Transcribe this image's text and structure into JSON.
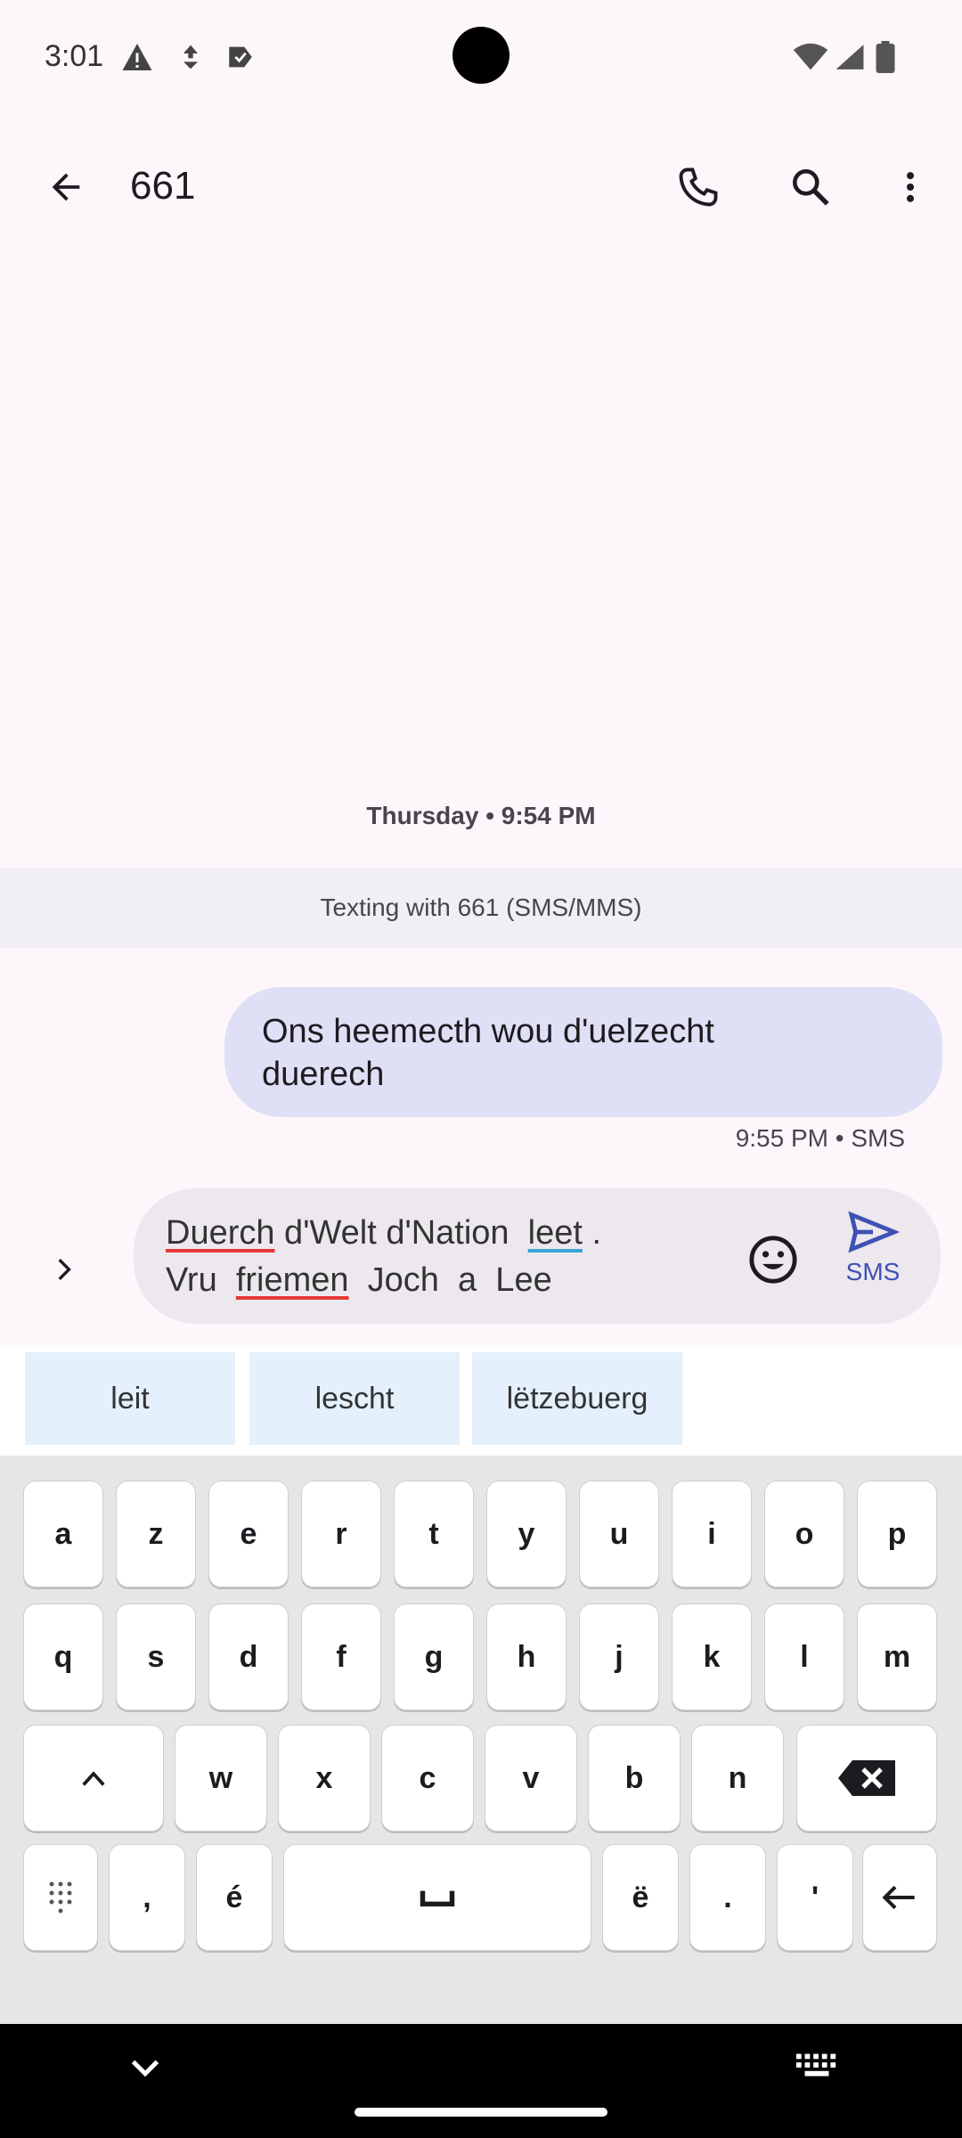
{
  "status_bar": {
    "time": "3:01"
  },
  "header": {
    "title": "661"
  },
  "conversation": {
    "date_divider": "Thursday • 9:54 PM",
    "texting_banner": "Texting with 661 (SMS/MMS)",
    "messages": [
      {
        "text_line1": "Ons heemecth  wou d'uelzecht",
        "text_line2": "duerech",
        "meta": "9:55 PM • SMS"
      }
    ]
  },
  "compose": {
    "words": [
      "Duerch",
      " d'Welt d'Nation  ",
      "leet",
      " .",
      "Vru  ",
      "friemen",
      "  Joch  a  Lee"
    ],
    "send_label": "SMS"
  },
  "keyboard": {
    "suggestions": [
      "leit",
      "lescht",
      "lëtzebuerg"
    ],
    "row1": [
      "a",
      "z",
      "e",
      "r",
      "t",
      "y",
      "u",
      "i",
      "o",
      "p"
    ],
    "row2": [
      "q",
      "s",
      "d",
      "f",
      "g",
      "h",
      "j",
      "k",
      "l",
      "m"
    ],
    "row3": [
      "w",
      "x",
      "c",
      "v",
      "b",
      "n"
    ],
    "row4": {
      "comma": ",",
      "e_acute": "é",
      "e_umlaut": "ë",
      "period": ".",
      "apostrophe": "'"
    }
  }
}
